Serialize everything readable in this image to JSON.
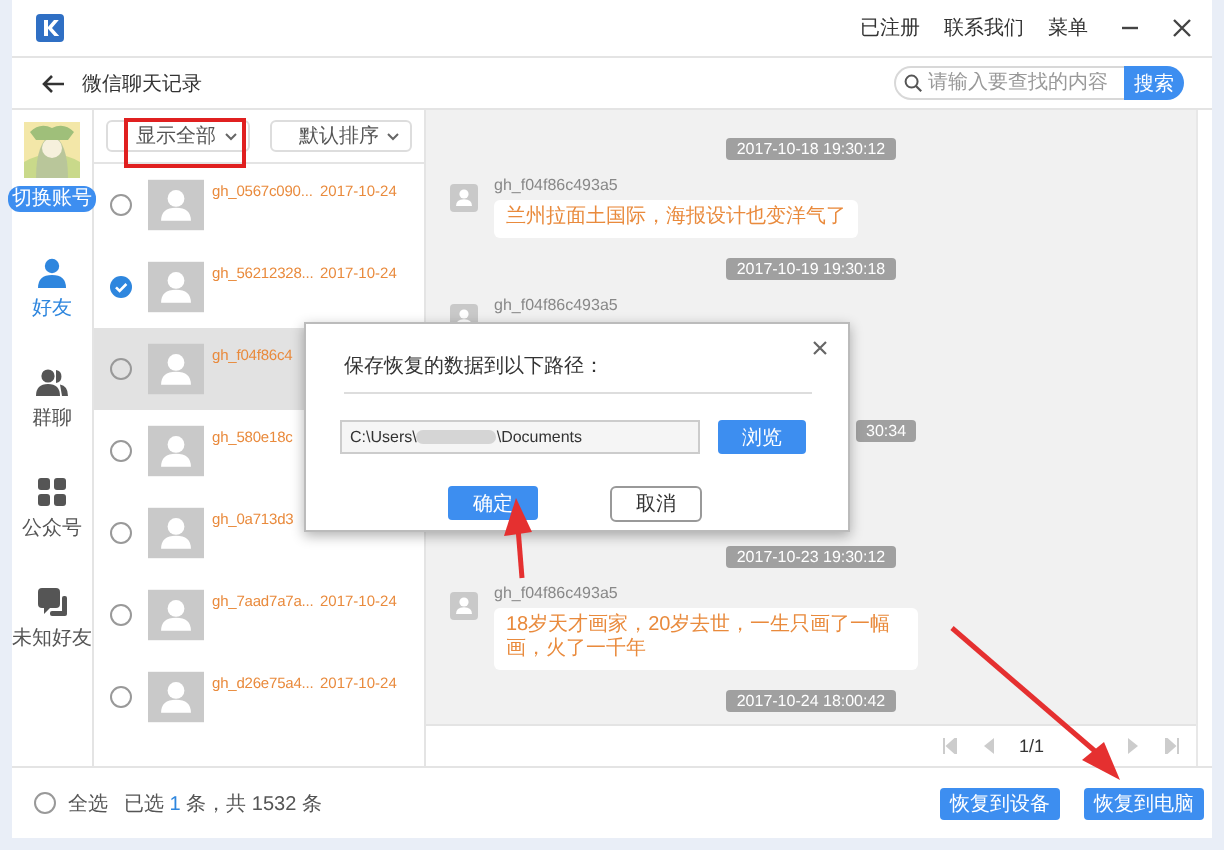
{
  "app": {
    "menu": [
      "已注册",
      "联系我们",
      "菜单"
    ]
  },
  "toolbar": {
    "title": "微信聊天记录",
    "search": {
      "placeholder": "请输入要查找的内容",
      "button": "搜索"
    }
  },
  "account": {
    "switch_label": "切换账号"
  },
  "nav": [
    {
      "label": "好友",
      "kind": "person",
      "selected": true
    },
    {
      "label": "群聊",
      "kind": "group",
      "selected": false
    },
    {
      "label": "公众号",
      "kind": "grid",
      "selected": false
    },
    {
      "label": "未知好友",
      "kind": "chat",
      "selected": false
    }
  ],
  "filters": [
    {
      "label": "显示全部"
    },
    {
      "label": "默认排序"
    }
  ],
  "contacts": [
    {
      "name": "gh_0567c090...",
      "date": "2017-10-24",
      "checked": false,
      "selected": false
    },
    {
      "name": "gh_56212328...",
      "date": "2017-10-24",
      "checked": true,
      "selected": false
    },
    {
      "name": "gh_f04f86c4",
      "checked": false,
      "selected": true
    },
    {
      "name": "gh_580e18c",
      "checked": false,
      "selected": false
    },
    {
      "name": "gh_0a713d3",
      "checked": false,
      "selected": false
    },
    {
      "name": "gh_7aad7a7a...",
      "date": "2017-10-24",
      "checked": false,
      "selected": false
    },
    {
      "name": "gh_d26e75a4...",
      "date": "2017-10-24",
      "checked": false,
      "selected": false
    }
  ],
  "chat": {
    "items": [
      {
        "kind": "timestamp",
        "text": "2017-10-18 19:30:12"
      },
      {
        "kind": "message",
        "sender": "gh_f04f86c493a5",
        "text": "兰州拉面土国际，海报设计也变洋气了"
      },
      {
        "kind": "timestamp",
        "text": "2017-10-19 19:30:18"
      },
      {
        "kind": "message",
        "sender": "gh_f04f86c493a5"
      },
      {
        "kind": "timestamp",
        "text": "30:34",
        "covered": true
      },
      {
        "kind": "timestamp",
        "text": "2017-10-23 19:30:12"
      },
      {
        "kind": "message",
        "sender": "gh_f04f86c493a5",
        "text": "18岁天才画家，20岁去世，一生只画了一幅画，火了一千年"
      },
      {
        "kind": "timestamp",
        "text": "2017-10-24 18:00:42"
      }
    ],
    "pager": {
      "label": "1/1"
    }
  },
  "dialog": {
    "title": "保存恢复的数据到以下路径：",
    "path_start": "C:\\Users\\",
    "path_end": "\\Documents",
    "browse": "浏览",
    "confirm": "确定",
    "cancel": "取消"
  },
  "footer": {
    "select_all": {
      "label": "全选",
      "checked": false
    },
    "summary": [
      {
        "text": "已选 ",
        "highlight": false
      },
      {
        "text": "1",
        "highlight": true
      },
      {
        "text": " 条，共 1532 条",
        "highlight": false
      }
    ],
    "buttons": [
      "恢复到设备",
      "恢复到电脑"
    ]
  }
}
